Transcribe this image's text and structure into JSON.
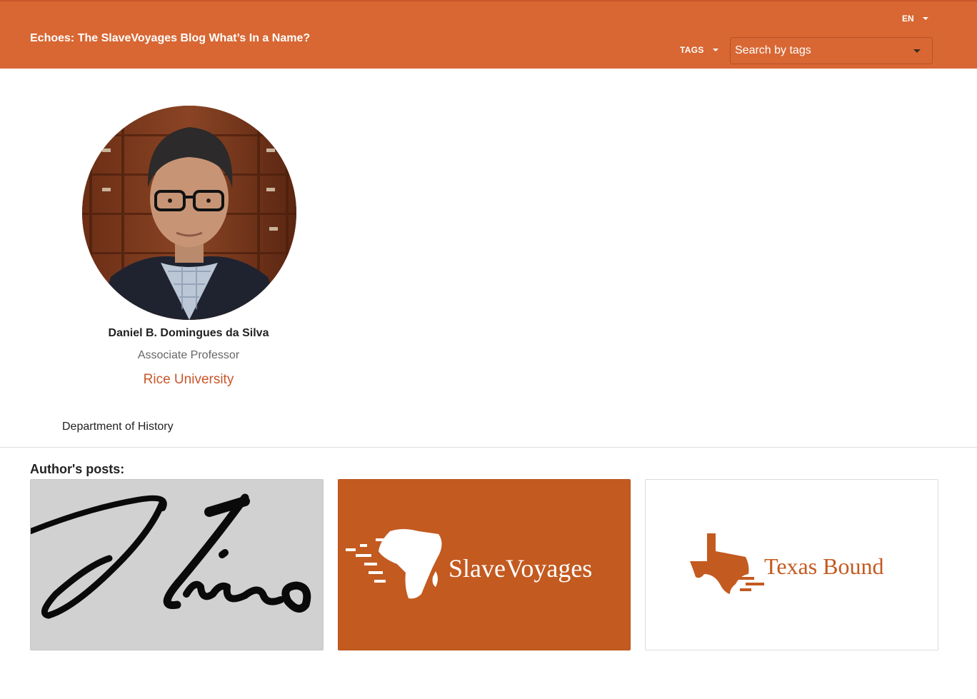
{
  "header": {
    "title": "Echoes: The SlaveVoyages Blog What’s In a Name?",
    "language": "EN",
    "tags_label": "TAGS",
    "tag_search_placeholder": "Search by tags"
  },
  "author": {
    "name": "Daniel B. Domingues da Silva",
    "role": "Associate Professor",
    "university": "Rice University",
    "department": "Department of History"
  },
  "posts": {
    "heading": "Author's posts:",
    "cards": [
      {
        "image": "signature-image"
      },
      {
        "image": "slavevoyages-logo",
        "logo_text": "SlaveVoyages"
      },
      {
        "image": "texas-bound-logo",
        "logo_text": "Texas Bound"
      }
    ]
  },
  "colors": {
    "brand": "#d86733",
    "accent": "#c9572a",
    "card_orange": "#c35a20"
  }
}
